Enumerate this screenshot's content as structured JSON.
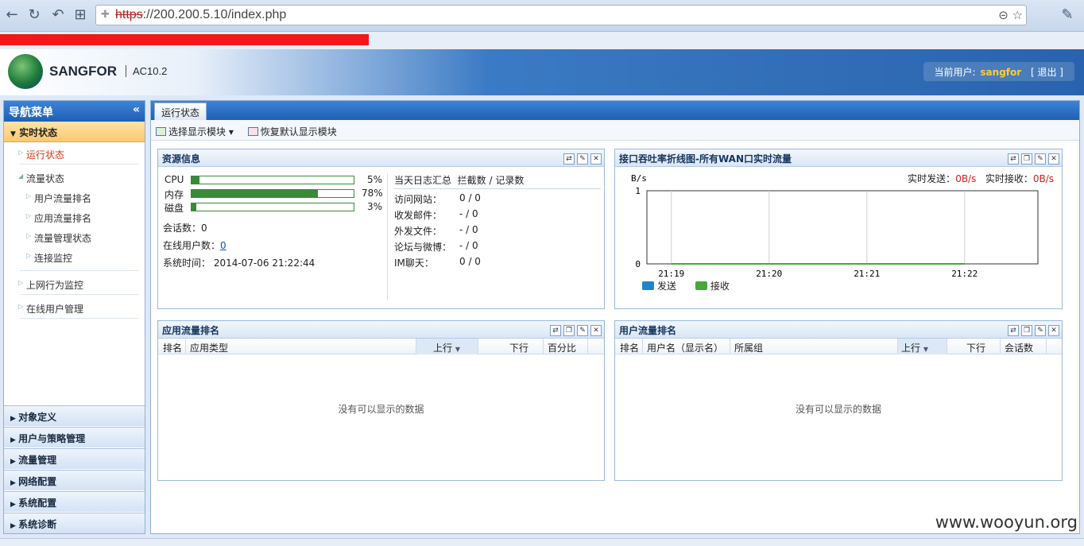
{
  "browser": {
    "url_scheme": "https",
    "url_rest": "://200.200.5.10/index.php"
  },
  "header": {
    "brand": "SANGFOR",
    "product": "AC10.2",
    "user_label": "当前用户:",
    "username": "sangfor",
    "logout": "[ 退出 ]"
  },
  "sidebar": {
    "title": "导航菜单",
    "collapse_icon": "«",
    "active_section": "实时状态",
    "items": [
      {
        "label": "运行状态"
      },
      {
        "label": "流量状态"
      },
      {
        "label": "用户流量排名"
      },
      {
        "label": "应用流量排名"
      },
      {
        "label": "流量管理状态"
      },
      {
        "label": "连接监控"
      },
      {
        "label": "上网行为监控"
      },
      {
        "label": "在线用户管理"
      }
    ],
    "groups": [
      {
        "label": "对象定义"
      },
      {
        "label": "用户与策略管理"
      },
      {
        "label": "流量管理"
      },
      {
        "label": "网络配置"
      },
      {
        "label": "系统配置"
      },
      {
        "label": "系统诊断"
      }
    ]
  },
  "main": {
    "tab": "运行状态",
    "toolbar": {
      "select_modules": "选择显示模块",
      "restore_default": "恢复默认显示模块"
    }
  },
  "resource_panel": {
    "title": "资源信息",
    "rows": [
      {
        "label": "CPU",
        "pct_text": "5%",
        "fraction": 0.05
      },
      {
        "label": "内存",
        "pct_text": "78%",
        "fraction": 0.78
      },
      {
        "label": "磁盘",
        "pct_text": "3%",
        "fraction": 0.03
      }
    ],
    "sessions": "会话数：0",
    "online_users_label": "在线用户数：",
    "online_users_value": "0",
    "system_time": "系统时间：  2014-07-06 21:22:44",
    "log_summary_label": "当天日志汇总",
    "log_summary_cols": "拦截数 / 记录数",
    "log_rows": [
      {
        "label": "访问网站：",
        "value": "0 / 0"
      },
      {
        "label": "收发邮件：",
        "value": "- / 0"
      },
      {
        "label": "外发文件：",
        "value": "- / 0"
      },
      {
        "label": "论坛与微博：",
        "value": "- / 0"
      },
      {
        "label": "IM聊天：",
        "value": "0 / 0"
      }
    ]
  },
  "throughput_panel": {
    "title": "接口吞吐率折线图-所有WAN口实时流量",
    "send_label": "实时发送：",
    "send_value": "0B/s",
    "recv_label": "实时接收：",
    "recv_value": "0B/s"
  },
  "chart_data": {
    "type": "line",
    "ylabel": "B/s",
    "ylim": [
      0,
      1
    ],
    "yticks": [
      "1",
      "0"
    ],
    "xticks": [
      "21:19",
      "21:20",
      "21:21",
      "21:22"
    ],
    "series": [
      {
        "name": "发送",
        "color": "#1f86c8",
        "values": [
          0,
          0,
          0,
          0
        ]
      },
      {
        "name": "接收",
        "color": "#4aa83a",
        "values": [
          0,
          0,
          0,
          0
        ]
      }
    ],
    "grid": true,
    "legend": "bottom-left"
  },
  "app_rank_panel": {
    "title": "应用流量排名",
    "columns": [
      "排名",
      "应用类型",
      "上行",
      "下行",
      "百分比"
    ],
    "empty": "没有可以显示的数据"
  },
  "user_rank_panel": {
    "title": "用户流量排名",
    "columns": [
      "排名",
      "用户名（显示名）",
      "所属组",
      "上行",
      "下行",
      "会话数"
    ],
    "empty": "没有可以显示的数据"
  },
  "watermark": "www.wooyun.org"
}
